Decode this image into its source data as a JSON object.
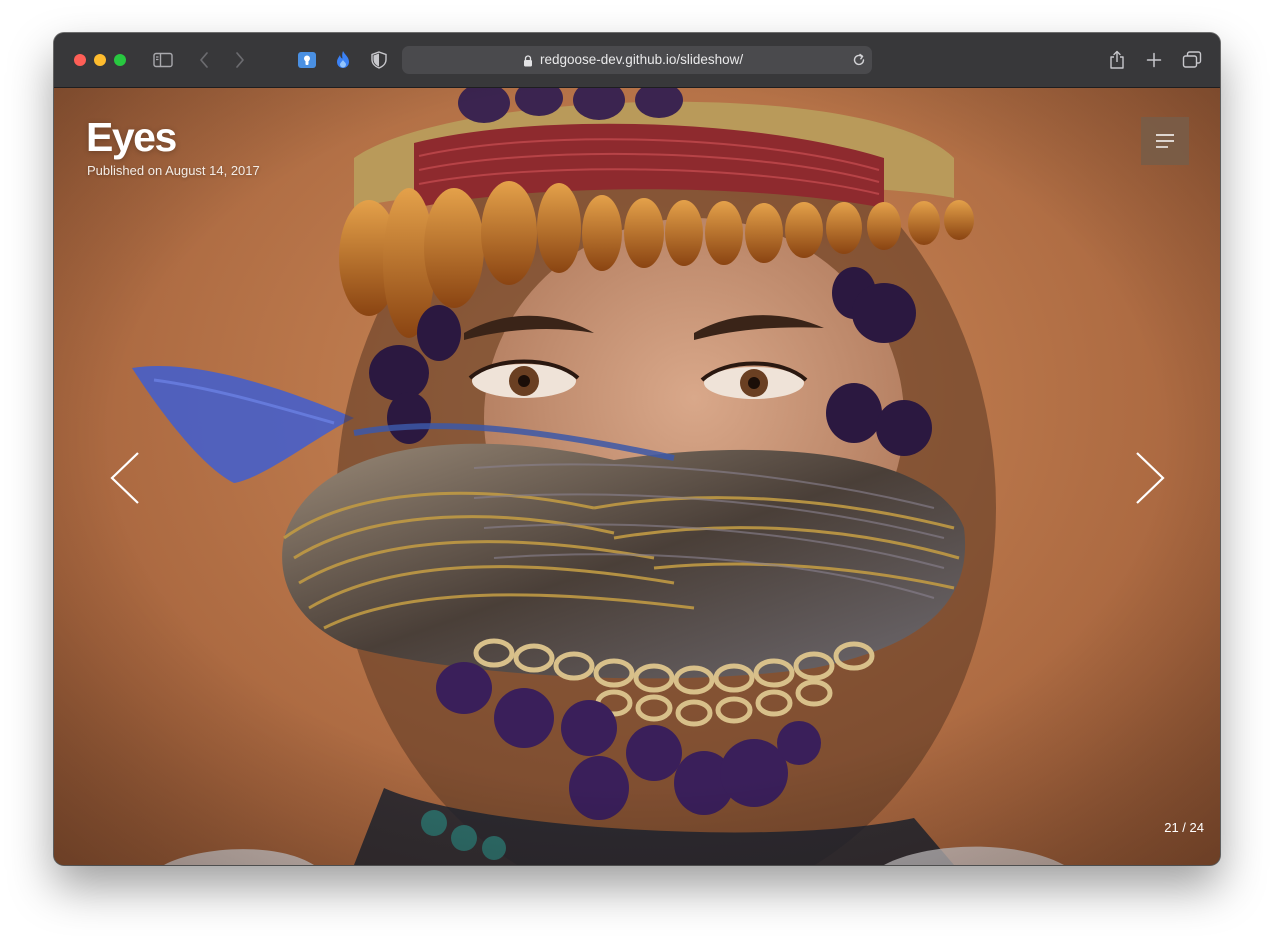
{
  "browser": {
    "url": "redgoose-dev.github.io/slideshow/",
    "icons": [
      "sidebar-icon",
      "back-icon",
      "forward-icon",
      "password-extension-icon",
      "flame-extension-icon",
      "shield-extension-icon",
      "lock-icon",
      "reload-icon",
      "share-icon",
      "new-tab-icon",
      "tab-overview-icon"
    ]
  },
  "slide": {
    "title": "Eyes",
    "published": "Published on August 14, 2017",
    "counter": "21 / 24"
  },
  "colors": {
    "toolbar": "#38383a",
    "address_bar": "#4a4a4d",
    "background_wall": "#b9764a",
    "menu_button": "#785c46",
    "traffic_red": "#fe5f57",
    "traffic_yellow": "#febc2e",
    "traffic_green": "#28c840",
    "extension_blue": "#3b82f6"
  }
}
